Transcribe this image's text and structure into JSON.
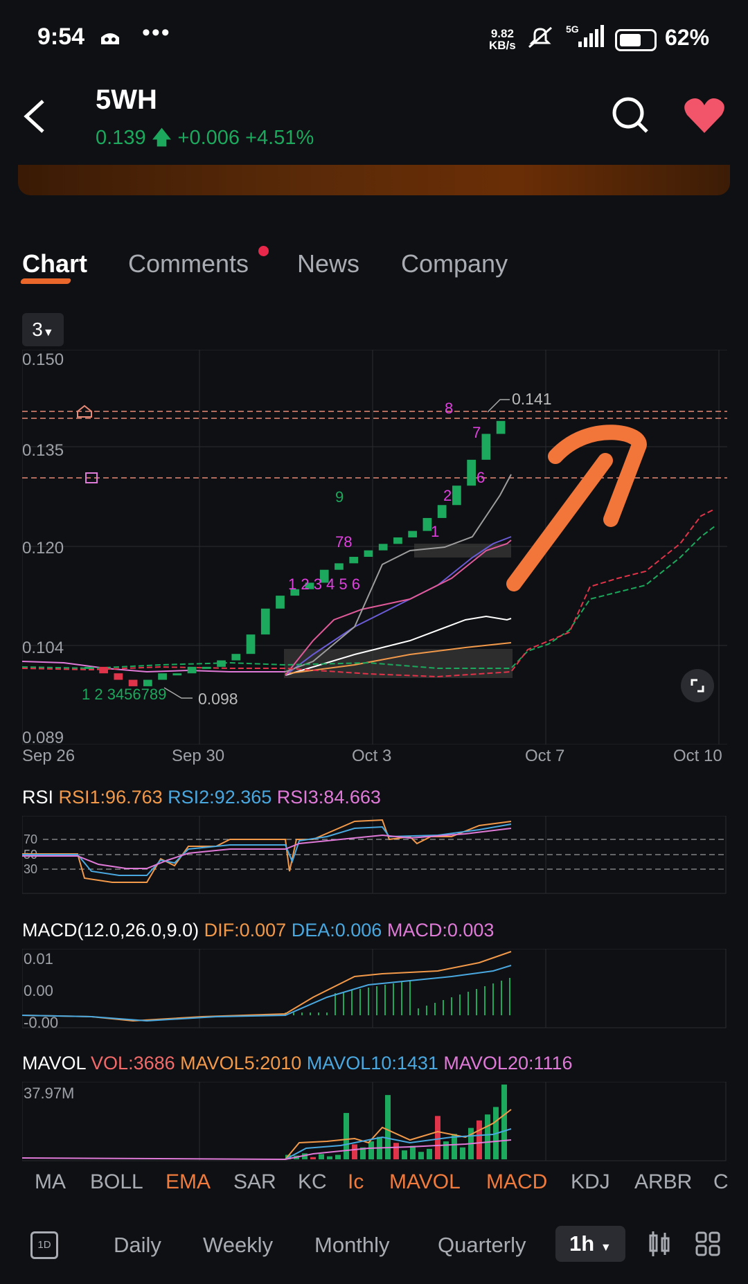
{
  "status_bar": {
    "time": "9:54",
    "speed_value": "9.82",
    "speed_unit": "KB/s",
    "network": "5G",
    "battery_pct": "62%"
  },
  "header": {
    "back_label": "<",
    "ticker": "5WH",
    "price": "0.139",
    "change": "+0.006",
    "change_pct": "+4.51%"
  },
  "tabs": [
    {
      "label": "Chart"
    },
    {
      "label": "Comments"
    },
    {
      "label": "News"
    },
    {
      "label": "Company"
    }
  ],
  "chart_selector": "3",
  "main_chart": {
    "y_ticks": [
      "0.150",
      "0.135",
      "0.120",
      "0.104",
      "0.089"
    ],
    "x_ticks": [
      "Sep 26",
      "Sep 30",
      "Oct 3",
      "Oct 7",
      "Oct 10"
    ],
    "high_label": "0.141",
    "low_label": "0.098"
  },
  "rsi": {
    "name": "RSI",
    "rsi1": "RSI1:96.763",
    "rsi2": "RSI2:92.365",
    "rsi3": "RSI3:84.663",
    "levels": [
      "70",
      "50",
      "30"
    ]
  },
  "macd": {
    "name": "MACD(12.0,26.0,9.0)",
    "dif": "DIF:0.007",
    "dea": "DEA:0.006",
    "macd": "MACD:0.003",
    "ticks": [
      "0.01",
      "0.00",
      "-0.00"
    ]
  },
  "mavol": {
    "name": "MAVOL",
    "vol": "VOL:3686",
    "ma5": "MAVOL5:2010",
    "ma10": "MAVOL10:1431",
    "ma20": "MAVOL20:1116",
    "max": "37.97M"
  },
  "indicator_tabs": [
    {
      "label": "MA",
      "active": false
    },
    {
      "label": "BOLL",
      "active": false
    },
    {
      "label": "EMA",
      "active": true
    },
    {
      "label": "SAR",
      "active": false
    },
    {
      "label": "KC",
      "active": false
    },
    {
      "label": "Ic",
      "active": true
    },
    {
      "label": "MAVOL",
      "active": true
    },
    {
      "label": "MACD",
      "active": true
    },
    {
      "label": "KDJ",
      "active": false
    },
    {
      "label": "ARBR",
      "active": false
    },
    {
      "label": "C",
      "active": false
    }
  ],
  "periods": {
    "icon": "1D",
    "daily": "Daily",
    "weekly": "Weekly",
    "monthly": "Monthly",
    "quarterly": "Quarterly",
    "active": "1h"
  },
  "colors": {
    "up": "#1ca85d",
    "down": "#e0344a",
    "accent": "#f07b3c",
    "rsi1": "#f2994a",
    "rsi2": "#4aa8e0",
    "rsi3": "#e07ad8"
  },
  "chart_data": {
    "type": "candlestick",
    "ylim": [
      0.089,
      0.15
    ],
    "x_ticks": [
      "Sep 26",
      "Sep 30",
      "Oct 3",
      "Oct 7",
      "Oct 10"
    ],
    "notable": {
      "high": 0.141,
      "low": 0.098,
      "last": 0.139
    },
    "close_approx": [
      0.101,
      0.1,
      0.099,
      0.098,
      0.099,
      0.1,
      0.1,
      0.101,
      0.101,
      0.102,
      0.103,
      0.106,
      0.11,
      0.112,
      0.113,
      0.114,
      0.116,
      0.117,
      0.118,
      0.119,
      0.12,
      0.121,
      0.122,
      0.124,
      0.126,
      0.129,
      0.133,
      0.137,
      0.139
    ]
  }
}
